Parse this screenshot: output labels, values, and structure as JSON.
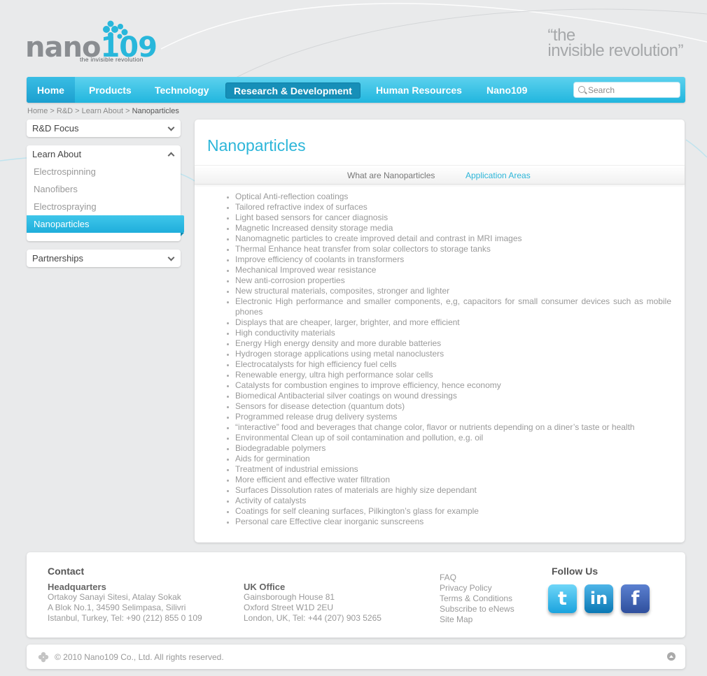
{
  "brand": {
    "logo_text_left": "nano",
    "logo_text_right": "109",
    "logo_tagline": "the invisible revolution",
    "tagline_line1": "“the",
    "tagline_line2": "invisible revolution”"
  },
  "nav": {
    "items": [
      {
        "label": "Home"
      },
      {
        "label": "Products"
      },
      {
        "label": "Technology"
      },
      {
        "label": "Research & Development"
      },
      {
        "label": "Human Resources"
      },
      {
        "label": "Nano109"
      }
    ],
    "search_placeholder": "Search"
  },
  "breadcrumb": [
    "Home",
    "R&D",
    "Learn About",
    "Nanoparticles"
  ],
  "sidebar": {
    "rd_focus": "R&D Focus",
    "learn_about": "Learn About",
    "learn_items": [
      "Electrospinning",
      "Nanofibers",
      "Electrospraying",
      "Nanoparticles"
    ],
    "partnerships": "Partnerships"
  },
  "content": {
    "title": "Nanoparticles",
    "tabs": [
      "What are Nanoparticles",
      "Application Areas"
    ],
    "applications": [
      "Optical Anti-reflection coatings",
      "Tailored refractive index of surfaces",
      "Light based sensors for cancer diagnosis",
      "Magnetic Increased density storage media",
      "Nanomagnetic particles to create improved detail and contrast in MRI images",
      "Thermal Enhance heat transfer from solar collectors to storage tanks",
      "Improve efficiency of coolants in transformers",
      "Mechanical Improved wear resistance",
      "New anti-corrosion properties",
      "New structural materials, composites, stronger and lighter",
      "Electronic High performance and smaller components, e,g, capacitors for small consumer devices such as mobile phones",
      "Displays that are cheaper, larger, brighter, and more efficient",
      "High conductivity materials",
      "Energy High energy density and more durable batteries",
      "Hydrogen storage applications using metal nanoclusters",
      "Electrocatalysts for high efficiency fuel cells",
      "Renewable energy, ultra high performance solar cells",
      "Catalysts for combustion engines to improve efficiency, hence economy",
      "Biomedical Antibacterial silver coatings on wound dressings",
      "Sensors for disease detection (quantum dots)",
      "Programmed release drug delivery systems",
      "“interactive” food and beverages that change color, flavor or nutrients depending on a diner’s taste or health",
      "Environmental Clean up of soil contamination and pollution, e.g. oil",
      "Biodegradable polymers",
      "Aids for germination",
      "Treatment of industrial emissions",
      "More efficient and effective water filtration",
      "Surfaces Dissolution rates of materials are highly size dependant",
      "Activity of catalysts",
      "Coatings for self cleaning surfaces, Pilkington’s glass for example",
      "Personal care Effective clear inorganic sunscreens"
    ]
  },
  "footer": {
    "contact_title": "Contact",
    "hq": {
      "title": "Headquarters",
      "lines": [
        "Ortakoy Sanayi Sitesi, Atalay Sokak",
        "A Blok No.1, 34590 Selimpasa, Silivri",
        "Istanbul, Turkey, Tel: +90 (212) 855 0 109"
      ]
    },
    "uk": {
      "title": "UK Office",
      "lines": [
        "Gainsborough House 81",
        "Oxford Street W1D 2EU",
        "London, UK, Tel: +44 (207) 903 5265"
      ]
    },
    "links": [
      "FAQ",
      "Privacy Policy",
      "Terms & Conditions",
      "Subscribe to eNews",
      "Site Map"
    ],
    "follow_title": "Follow Us",
    "social": [
      "twitter-icon",
      "linkedin-icon",
      "facebook-icon"
    ],
    "copyright": "© 2010 Nano109 Co., Ltd. All rights reserved."
  },
  "colors": {
    "accent": "#2db6d9",
    "nav_active": "#168fb8",
    "background": "#e9eaeb"
  }
}
